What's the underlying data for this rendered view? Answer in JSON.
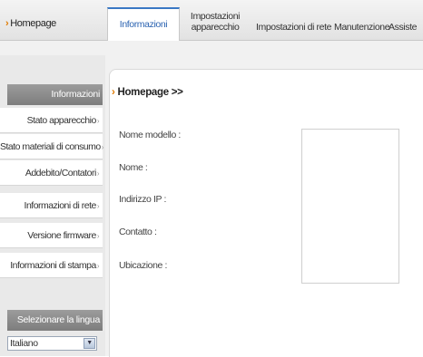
{
  "nav": {
    "home": "Homepage",
    "tabs": [
      "Informazioni",
      "Impostazioni apparecchio",
      "Impostazioni di rete",
      "Manutenzione",
      "Assiste"
    ]
  },
  "sidebar": {
    "header": "Informazioni",
    "items": [
      {
        "label": "Stato apparecchio"
      },
      {
        "label": "Stato materiali di consumo"
      },
      {
        "label": "Addebito/Contatori"
      },
      {
        "label": "Informazioni di rete"
      },
      {
        "label": "Versione firmware"
      },
      {
        "label": "Informazioni di stampa"
      }
    ],
    "language_header": "Selezionare la lingua",
    "language_selected": "Italiano"
  },
  "main": {
    "breadcrumb": "Homepage >>",
    "fields": [
      "Nome modello :",
      "Nome :",
      "Indirizzo IP :",
      "Contatto :",
      "Ubicazione :"
    ]
  },
  "colors": {
    "accent": "#3a78c4",
    "arrow": "#e07a00",
    "sidebar_header": "#8c8c8c"
  }
}
